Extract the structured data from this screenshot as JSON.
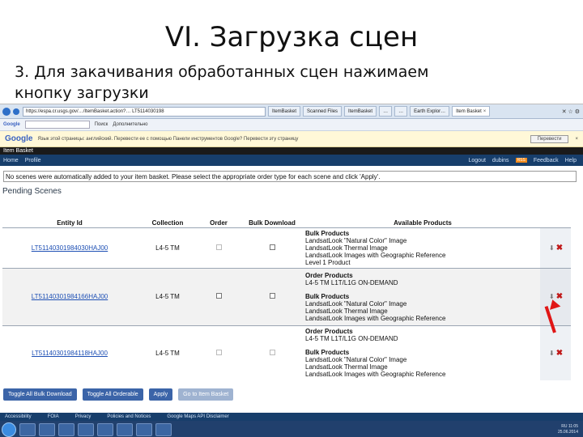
{
  "slide": {
    "title": "VI. Загрузка сцен",
    "subtitle_line1": "3. Для закачивания обработанных сцен нажимаем",
    "subtitle_line2": "кнопку загрузки"
  },
  "browser": {
    "url": "https://espa.cr.usgs.gov/…/ItemBasket.action?… LT5114030198",
    "tabs": [
      {
        "label": "ItemBasket"
      },
      {
        "label": "Scanned Files"
      },
      {
        "label": "ItemBasket"
      },
      {
        "label": "…"
      },
      {
        "label": "…"
      },
      {
        "label": "Earth Explor…"
      },
      {
        "label": "Item Basket"
      }
    ],
    "window_controls": "✕ ☆ ⚙"
  },
  "google_toolbar": {
    "label": "Google",
    "items": [
      "Поиск",
      "Дополнительно"
    ]
  },
  "translate_bar": {
    "logo": "Google",
    "text": "Язык этой страницы: английский. Перевести ее с помощью Панели инструментов Google? Перевести эту страницу",
    "button": "Перевести"
  },
  "site": {
    "header": "Item Basket",
    "nav": [
      "Home",
      "Profile"
    ],
    "nav_right": [
      "Logout",
      "dubins",
      "RSS",
      "Feedback",
      "Help"
    ],
    "notice": "No scenes were automatically added to your item basket. Please select the appropriate order type for each scene and click 'Apply'.",
    "section_title": "Pending Scenes"
  },
  "table": {
    "headers": [
      "Entity Id",
      "Collection",
      "Order",
      "Bulk Download",
      "Available Products"
    ],
    "rows": [
      {
        "entity_id": "LT51140301984030HAJ00",
        "collection": "L4-5 TM",
        "products": [
          {
            "heading": "Bulk Products",
            "items": [
              "LandsatLook \"Natural Color\" Image",
              "LandsatLook Thermal Image",
              "LandsatLook Images with Geographic Reference",
              "Level 1 Product"
            ]
          }
        ]
      },
      {
        "entity_id": "LT51140301984166HAJ00",
        "collection": "L4-5 TM",
        "products": [
          {
            "heading": "Order Products",
            "items": [
              "L4-5 TM L1T/L1G ON-DEMAND"
            ]
          },
          {
            "heading": "Bulk Products",
            "items": [
              "LandsatLook \"Natural Color\" Image",
              "LandsatLook Thermal Image",
              "LandsatLook Images with Geographic Reference"
            ]
          }
        ]
      },
      {
        "entity_id": "LT51140301984118HAJ00",
        "collection": "L4-5 TM",
        "products": [
          {
            "heading": "Order Products",
            "items": [
              "L4-5 TM L1T/L1G ON-DEMAND"
            ]
          },
          {
            "heading": "Bulk Products",
            "items": [
              "LandsatLook \"Natural Color\" Image",
              "LandsatLook Thermal Image",
              "LandsatLook Images with Geographic Reference"
            ]
          }
        ]
      }
    ]
  },
  "buttons": {
    "toggle_bulk": "Toggle All Bulk Download",
    "toggle_orderable": "Toggle All Orderable",
    "apply": "Apply",
    "go_basket": "Go to Item Basket"
  },
  "footer": [
    "Accessibility",
    "FOIA",
    "Privacy",
    "Policies and Notices",
    "Google Maps API Disclaimer"
  ],
  "taskbar": {
    "language": "RU",
    "time": "11:05",
    "date": "25.06.2014"
  },
  "colors": {
    "site_nav": "#173e6b",
    "button": "#3b64a8",
    "delete": "#c01818",
    "annotation_arrow": "#e01616"
  }
}
